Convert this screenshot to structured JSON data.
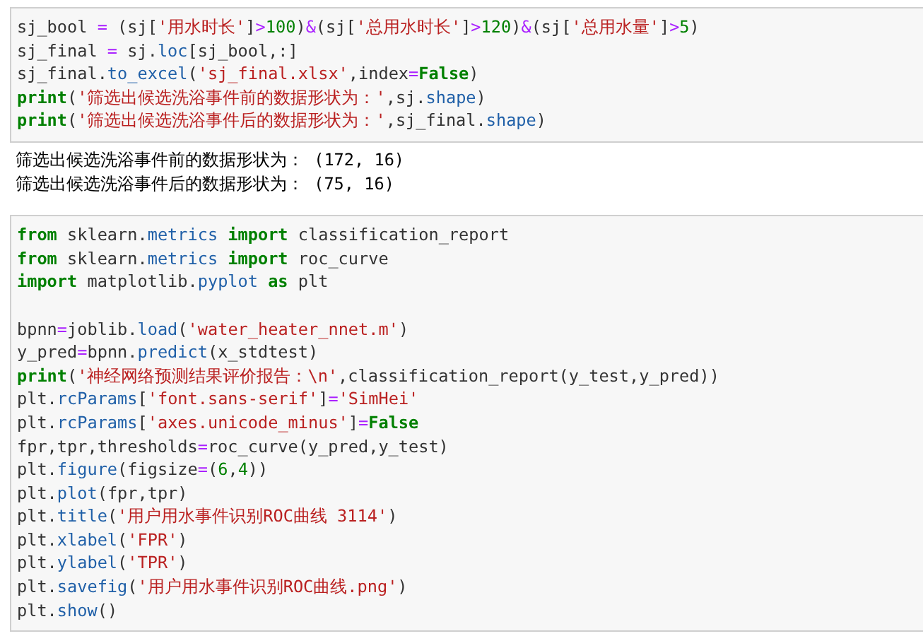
{
  "cells": [
    {
      "kind": "code",
      "lines": [
        {
          "kind": "code",
          "tokens": [
            {
              "kind": "plain",
              "text": "sj_bool "
            },
            {
              "kind": "op",
              "text": "="
            },
            {
              "kind": "plain",
              "text": " (sj["
            },
            {
              "kind": "str",
              "text": "'用水时长'"
            },
            {
              "kind": "plain",
              "text": "]"
            },
            {
              "kind": "op",
              "text": ">"
            },
            {
              "kind": "num",
              "text": "100"
            },
            {
              "kind": "plain",
              "text": ")"
            },
            {
              "kind": "op",
              "text": "&"
            },
            {
              "kind": "plain",
              "text": "(sj["
            },
            {
              "kind": "str",
              "text": "'总用水时长'"
            },
            {
              "kind": "plain",
              "text": "]"
            },
            {
              "kind": "op",
              "text": ">"
            },
            {
              "kind": "num",
              "text": "120"
            },
            {
              "kind": "plain",
              "text": ")"
            },
            {
              "kind": "op",
              "text": "&"
            },
            {
              "kind": "plain",
              "text": "(sj["
            },
            {
              "kind": "str",
              "text": "'总用水量'"
            },
            {
              "kind": "plain",
              "text": "]"
            },
            {
              "kind": "op",
              "text": ">"
            },
            {
              "kind": "num",
              "text": "5"
            },
            {
              "kind": "plain",
              "text": ")"
            }
          ]
        },
        {
          "kind": "code",
          "tokens": [
            {
              "kind": "plain",
              "text": "sj_final "
            },
            {
              "kind": "op",
              "text": "="
            },
            {
              "kind": "plain",
              "text": " sj."
            },
            {
              "kind": "attr",
              "text": "loc"
            },
            {
              "kind": "plain",
              "text": "[sj_bool,:]"
            }
          ]
        },
        {
          "kind": "code",
          "tokens": [
            {
              "kind": "plain",
              "text": "sj_final."
            },
            {
              "kind": "attr",
              "text": "to_excel"
            },
            {
              "kind": "plain",
              "text": "("
            },
            {
              "kind": "str",
              "text": "'sj_final.xlsx'"
            },
            {
              "kind": "plain",
              "text": ",index"
            },
            {
              "kind": "op",
              "text": "="
            },
            {
              "kind": "kw",
              "text": "False"
            },
            {
              "kind": "plain",
              "text": ")"
            }
          ]
        },
        {
          "kind": "code",
          "tokens": [
            {
              "kind": "kw",
              "text": "print"
            },
            {
              "kind": "plain",
              "text": "("
            },
            {
              "kind": "str",
              "text": "'筛选出候选洗浴事件前的数据形状为：'"
            },
            {
              "kind": "plain",
              "text": ",sj."
            },
            {
              "kind": "attr",
              "text": "shape"
            },
            {
              "kind": "plain",
              "text": ")"
            }
          ]
        },
        {
          "kind": "code",
          "tokens": [
            {
              "kind": "kw",
              "text": "print"
            },
            {
              "kind": "plain",
              "text": "("
            },
            {
              "kind": "str",
              "text": "'筛选出候选洗浴事件后的数据形状为：'"
            },
            {
              "kind": "plain",
              "text": ",sj_final."
            },
            {
              "kind": "attr",
              "text": "shape"
            },
            {
              "kind": "plain",
              "text": ")"
            }
          ]
        }
      ]
    },
    {
      "kind": "output",
      "lines": [
        "筛选出候选洗浴事件前的数据形状为： (172, 16)",
        "筛选出候选洗浴事件后的数据形状为： (75, 16)"
      ]
    },
    {
      "kind": "code",
      "lines": [
        {
          "kind": "code",
          "tokens": [
            {
              "kind": "kw",
              "text": "from"
            },
            {
              "kind": "plain",
              "text": " sklearn."
            },
            {
              "kind": "attr",
              "text": "metrics "
            },
            {
              "kind": "kw",
              "text": "import"
            },
            {
              "kind": "plain",
              "text": " classification_report"
            }
          ]
        },
        {
          "kind": "code",
          "tokens": [
            {
              "kind": "kw",
              "text": "from"
            },
            {
              "kind": "plain",
              "text": " sklearn."
            },
            {
              "kind": "attr",
              "text": "metrics "
            },
            {
              "kind": "kw",
              "text": "import"
            },
            {
              "kind": "plain",
              "text": " roc_curve"
            }
          ]
        },
        {
          "kind": "code",
          "tokens": [
            {
              "kind": "kw",
              "text": "import"
            },
            {
              "kind": "plain",
              "text": " matplotlib."
            },
            {
              "kind": "attr",
              "text": "pyplot "
            },
            {
              "kind": "kw",
              "text": "as"
            },
            {
              "kind": "plain",
              "text": " plt"
            }
          ]
        },
        {
          "kind": "blank"
        },
        {
          "kind": "code",
          "tokens": [
            {
              "kind": "plain",
              "text": "bpnn"
            },
            {
              "kind": "op",
              "text": "="
            },
            {
              "kind": "plain",
              "text": "joblib."
            },
            {
              "kind": "attr",
              "text": "load"
            },
            {
              "kind": "plain",
              "text": "("
            },
            {
              "kind": "str",
              "text": "'water_heater_nnet.m'"
            },
            {
              "kind": "plain",
              "text": ")"
            }
          ]
        },
        {
          "kind": "code",
          "tokens": [
            {
              "kind": "plain",
              "text": "y_pred"
            },
            {
              "kind": "op",
              "text": "="
            },
            {
              "kind": "plain",
              "text": "bpnn."
            },
            {
              "kind": "attr",
              "text": "predict"
            },
            {
              "kind": "plain",
              "text": "(x_stdtest)"
            }
          ]
        },
        {
          "kind": "code",
          "tokens": [
            {
              "kind": "kw",
              "text": "print"
            },
            {
              "kind": "plain",
              "text": "("
            },
            {
              "kind": "str",
              "text": "'神经网络预测结果评价报告：\\n'"
            },
            {
              "kind": "plain",
              "text": ",classification_report(y_test,y_pred))"
            }
          ]
        },
        {
          "kind": "code",
          "tokens": [
            {
              "kind": "plain",
              "text": "plt."
            },
            {
              "kind": "attr",
              "text": "rcParams"
            },
            {
              "kind": "plain",
              "text": "["
            },
            {
              "kind": "str",
              "text": "'font.sans-serif'"
            },
            {
              "kind": "plain",
              "text": "]"
            },
            {
              "kind": "op",
              "text": "="
            },
            {
              "kind": "str",
              "text": "'SimHei'"
            }
          ]
        },
        {
          "kind": "code",
          "tokens": [
            {
              "kind": "plain",
              "text": "plt."
            },
            {
              "kind": "attr",
              "text": "rcParams"
            },
            {
              "kind": "plain",
              "text": "["
            },
            {
              "kind": "str",
              "text": "'axes.unicode_minus'"
            },
            {
              "kind": "plain",
              "text": "]"
            },
            {
              "kind": "op",
              "text": "="
            },
            {
              "kind": "kw",
              "text": "False"
            }
          ]
        },
        {
          "kind": "code",
          "tokens": [
            {
              "kind": "plain",
              "text": "fpr,tpr,thresholds"
            },
            {
              "kind": "op",
              "text": "="
            },
            {
              "kind": "plain",
              "text": "roc_curve(y_pred,y_test)"
            }
          ]
        },
        {
          "kind": "code",
          "tokens": [
            {
              "kind": "plain",
              "text": "plt."
            },
            {
              "kind": "attr",
              "text": "figure"
            },
            {
              "kind": "plain",
              "text": "(figsize"
            },
            {
              "kind": "op",
              "text": "="
            },
            {
              "kind": "plain",
              "text": "("
            },
            {
              "kind": "num",
              "text": "6"
            },
            {
              "kind": "plain",
              "text": ","
            },
            {
              "kind": "num",
              "text": "4"
            },
            {
              "kind": "plain",
              "text": "))"
            }
          ]
        },
        {
          "kind": "code",
          "tokens": [
            {
              "kind": "plain",
              "text": "plt."
            },
            {
              "kind": "attr",
              "text": "plot"
            },
            {
              "kind": "plain",
              "text": "(fpr,tpr)"
            }
          ]
        },
        {
          "kind": "code",
          "tokens": [
            {
              "kind": "plain",
              "text": "plt."
            },
            {
              "kind": "attr",
              "text": "title"
            },
            {
              "kind": "plain",
              "text": "("
            },
            {
              "kind": "str",
              "text": "'用户用水事件识别ROC曲线 3114'"
            },
            {
              "kind": "plain",
              "text": ")"
            }
          ]
        },
        {
          "kind": "code",
          "tokens": [
            {
              "kind": "plain",
              "text": "plt."
            },
            {
              "kind": "attr",
              "text": "xlabel"
            },
            {
              "kind": "plain",
              "text": "("
            },
            {
              "kind": "str",
              "text": "'FPR'"
            },
            {
              "kind": "plain",
              "text": ")"
            }
          ]
        },
        {
          "kind": "code",
          "tokens": [
            {
              "kind": "plain",
              "text": "plt."
            },
            {
              "kind": "attr",
              "text": "ylabel"
            },
            {
              "kind": "plain",
              "text": "("
            },
            {
              "kind": "str",
              "text": "'TPR'"
            },
            {
              "kind": "plain",
              "text": ")"
            }
          ]
        },
        {
          "kind": "code",
          "tokens": [
            {
              "kind": "plain",
              "text": "plt."
            },
            {
              "kind": "attr",
              "text": "savefig"
            },
            {
              "kind": "plain",
              "text": "("
            },
            {
              "kind": "str",
              "text": "'用户用水事件识别ROC曲线.png'"
            },
            {
              "kind": "plain",
              "text": ")"
            }
          ]
        },
        {
          "kind": "code",
          "tokens": [
            {
              "kind": "plain",
              "text": "plt."
            },
            {
              "kind": "attr",
              "text": "show"
            },
            {
              "kind": "plain",
              "text": "()"
            }
          ]
        }
      ]
    }
  ]
}
